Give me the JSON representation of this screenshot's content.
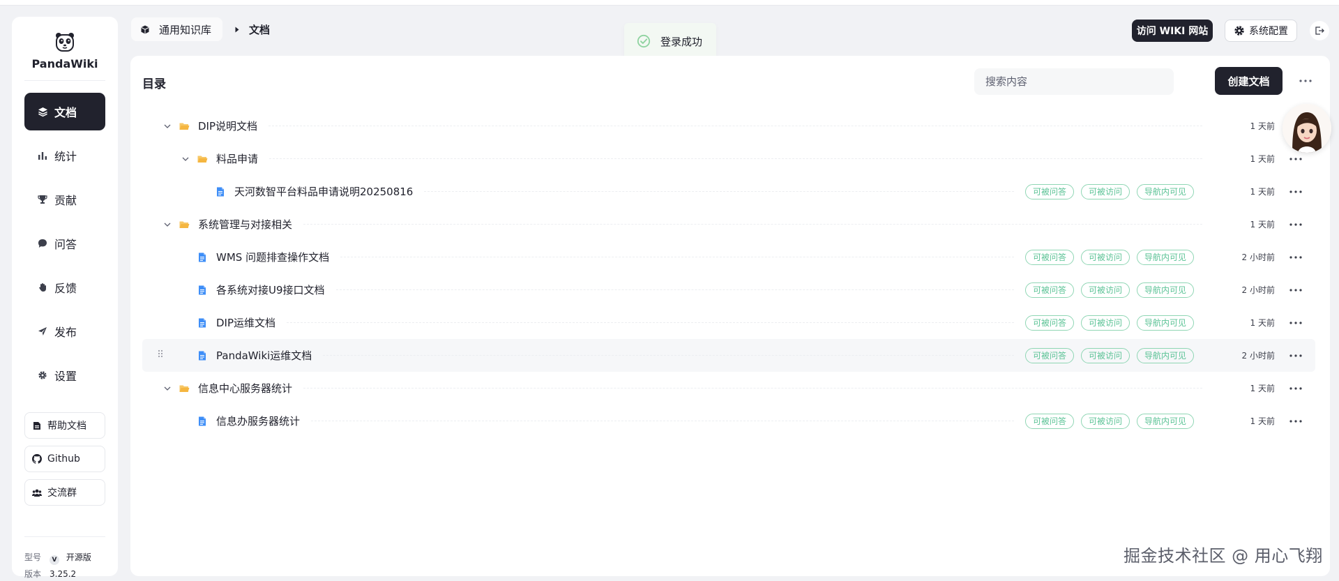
{
  "app": {
    "name": "PandaWiki"
  },
  "sidebar": {
    "nav": [
      {
        "label": "文档",
        "icon": "layers-icon",
        "active": true
      },
      {
        "label": "统计",
        "icon": "bar-chart-icon",
        "active": false
      },
      {
        "label": "贡献",
        "icon": "trophy-icon",
        "active": false
      },
      {
        "label": "问答",
        "icon": "chat-bubble-icon",
        "active": false
      },
      {
        "label": "反馈",
        "icon": "hand-icon",
        "active": false
      },
      {
        "label": "发布",
        "icon": "send-icon",
        "active": false
      },
      {
        "label": "设置",
        "icon": "gear-icon",
        "active": false
      }
    ],
    "buttons": [
      {
        "label": "帮助文档",
        "icon": "doc-icon"
      },
      {
        "label": "Github",
        "icon": "github-icon"
      },
      {
        "label": "交流群",
        "icon": "group-icon"
      }
    ],
    "meta": {
      "model_label": "型号",
      "model_value": "开源版",
      "model_badge": "V",
      "version_label": "版本",
      "version_value": "3.25.2"
    }
  },
  "header": {
    "knowledge_base": "通用知识库",
    "current": "文档",
    "visit_wiki": "访问 WIKI 网站",
    "system_config": "系统配置"
  },
  "toast": {
    "text": "登录成功",
    "color": "#52c41a"
  },
  "main": {
    "title": "目录",
    "search_placeholder": "搜索内容",
    "create_button": "创建文档",
    "tags": {
      "qa": "可被问答",
      "access": "可被访问",
      "nav": "导航内可见"
    },
    "rows": [
      {
        "type": "folder",
        "level": 0,
        "label": "DIP说明文档",
        "time": "1 天前",
        "tags": false,
        "more": false
      },
      {
        "type": "folder",
        "level": 1,
        "label": "料品申请",
        "time": "1 天前",
        "tags": false,
        "more": true
      },
      {
        "type": "doc",
        "level": 2,
        "label": "天河数智平台料品申请说明20250816",
        "time": "1 天前",
        "tags": true,
        "more": true
      },
      {
        "type": "folder",
        "level": 0,
        "label": "系统管理与对接相关",
        "time": "1 天前",
        "tags": false,
        "more": true
      },
      {
        "type": "doc",
        "level": 1,
        "label": "WMS 问题排查操作文档",
        "time": "2 小时前",
        "tags": true,
        "more": true
      },
      {
        "type": "doc",
        "level": 1,
        "label": "各系统对接U9接口文档",
        "time": "2 小时前",
        "tags": true,
        "more": true
      },
      {
        "type": "doc",
        "level": 1,
        "label": "DIP运维文档",
        "time": "1 天前",
        "tags": true,
        "more": true
      },
      {
        "type": "doc",
        "level": 1,
        "label": "PandaWiki运维文档",
        "time": "2 小时前",
        "tags": true,
        "more": true,
        "hover": true
      },
      {
        "type": "folder",
        "level": 0,
        "label": "信息中心服务器统计",
        "time": "1 天前",
        "tags": false,
        "more": true
      },
      {
        "type": "doc",
        "level": 1,
        "label": "信息办服务器统计",
        "time": "1 天前",
        "tags": true,
        "more": true
      }
    ]
  },
  "watermark": "掘金技术社区 @ 用心飞翔",
  "colors": {
    "primary": "#21222d",
    "tag": "#5cc396",
    "folder": "#f5b640",
    "doc": "#3e8ef7"
  }
}
